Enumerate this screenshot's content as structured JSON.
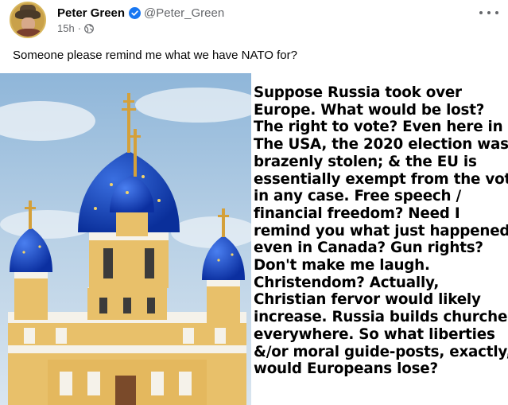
{
  "post": {
    "author_name": "Peter Green",
    "handle": "@Peter_Green",
    "timestamp": "15h",
    "separator": "·",
    "text": "Someone please remind me what we have NATO for?"
  },
  "icons": {
    "verified": "verified-badge-icon",
    "audience": "globe-icon",
    "more": "more-options-icon"
  },
  "colors": {
    "verified": "#1877f2",
    "secondary_text": "#65676b"
  },
  "image_text_lines": [
    "Suppose Russia took over",
    "Europe.  What would be lost?",
    "The right to vote?  Even here in",
    "The USA, the 2020 election was",
    "brazenly stolen; & the EU is",
    "essentially exempt from the vote",
    "in any case.  Free speech /",
    "financial freedom?  Need I",
    "remind you what just happened",
    "even in Canada?  Gun rights?",
    "Don't make me laugh.",
    "Christendom?  Actually,",
    "Christian fervor would likely",
    "increase.  Russia builds churches",
    "everywhere.  So what liberties",
    "&/or moral guide-posts, exactly,",
    "would Europeans lose?"
  ]
}
